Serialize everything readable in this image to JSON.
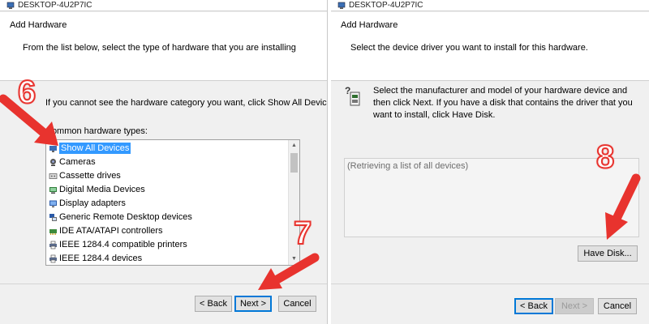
{
  "left_window": {
    "title": "DESKTOP-4U2P7IC",
    "header_title": "Add Hardware",
    "header_subtitle": "From the list below, select the type of hardware that you are installing",
    "instruction": "If you cannot see the hardware category you want, click Show All Devices.",
    "list_label": "Common hardware types:",
    "list_items": [
      {
        "label": "Show All Devices",
        "icon": "show-all-devices-icon",
        "selected": true
      },
      {
        "label": "Cameras",
        "icon": "camera-icon",
        "selected": false
      },
      {
        "label": "Cassette drives",
        "icon": "cassette-drive-icon",
        "selected": false
      },
      {
        "label": "Digital Media Devices",
        "icon": "digital-media-icon",
        "selected": false
      },
      {
        "label": "Display adapters",
        "icon": "display-adapter-icon",
        "selected": false
      },
      {
        "label": "Generic Remote Desktop devices",
        "icon": "remote-desktop-icon",
        "selected": false
      },
      {
        "label": "IDE ATA/ATAPI controllers",
        "icon": "ide-controller-icon",
        "selected": false
      },
      {
        "label": "IEEE 1284.4 compatible printers",
        "icon": "printer-icon",
        "selected": false
      },
      {
        "label": "IEEE 1284.4 devices",
        "icon": "printer-icon",
        "selected": false
      }
    ],
    "buttons": {
      "back": "< Back",
      "next": "Next >",
      "cancel": "Cancel"
    }
  },
  "right_window": {
    "title": "DESKTOP-4U2P7IC",
    "header_title": "Add Hardware",
    "header_subtitle": "Select the device driver you want to install for this hardware.",
    "instruction": "Select the manufacturer and model of your hardware device and then click Next. If you have a disk that contains the driver that you want to install, click Have Disk.",
    "loading_text": "(Retrieving a list of all devices)",
    "buttons": {
      "have_disk": "Have Disk...",
      "back": "< Back",
      "next": "Next >",
      "cancel": "Cancel"
    }
  },
  "annotations": {
    "step6": "6",
    "step7": "7",
    "step8": "8",
    "arrow_color": "#e8332e"
  }
}
